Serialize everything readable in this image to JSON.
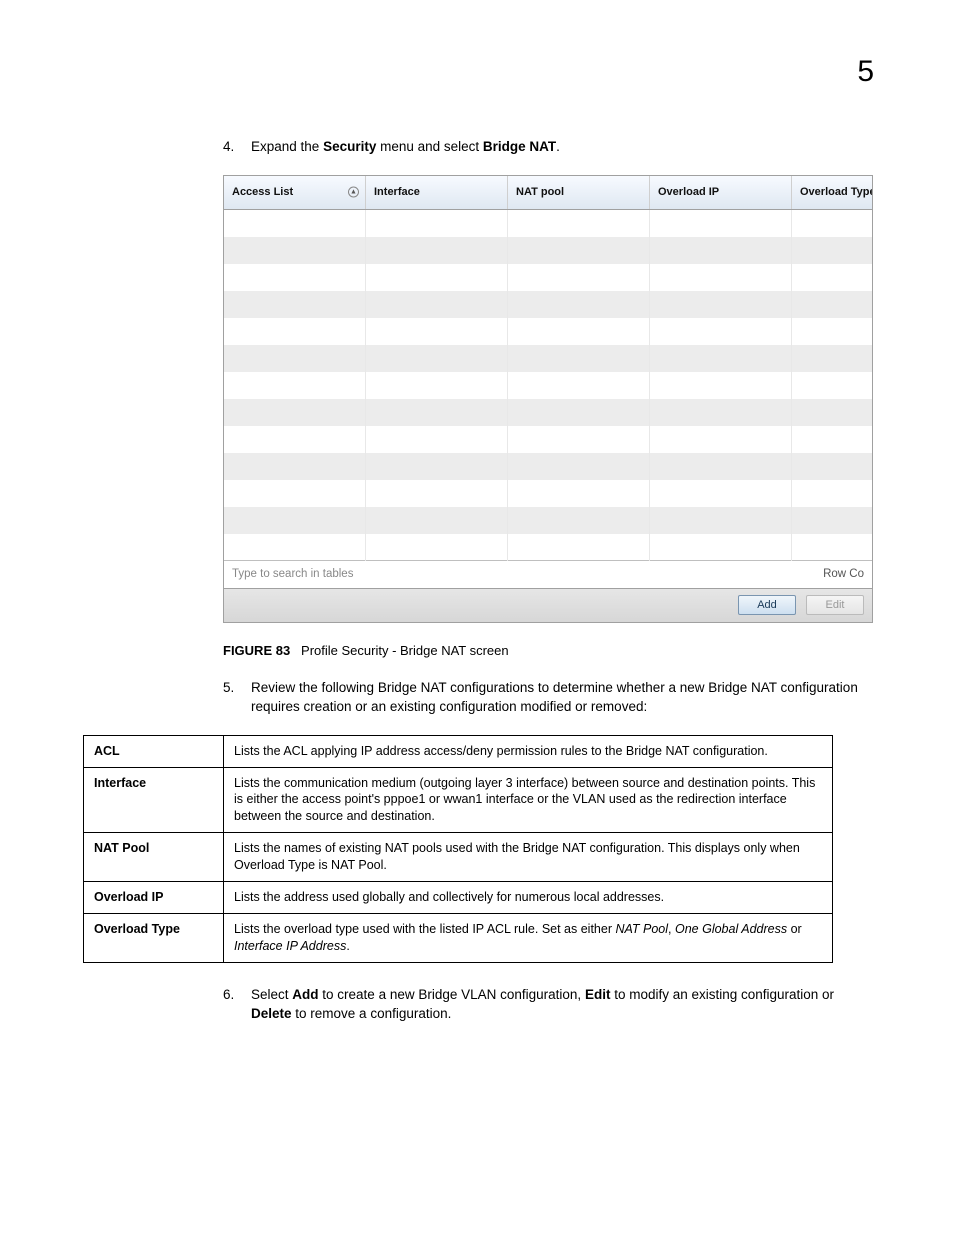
{
  "page_number": "5",
  "steps": {
    "s4": {
      "num": "4.",
      "prefix": "Expand the ",
      "b1": "Security",
      "mid": " menu and select ",
      "b2": "Bridge NAT",
      "suffix": "."
    },
    "s5": {
      "num": "5.",
      "text": "Review the following Bridge NAT configurations to determine whether a new Bridge NAT configuration requires creation or an existing configuration modified or removed:"
    },
    "s6": {
      "num": "6.",
      "p1": "Select ",
      "b1": "Add",
      "p2": " to create a new Bridge VLAN configuration, ",
      "b2": "Edit",
      "p3": " to modify an existing configuration or ",
      "b3": "Delete",
      "p4": " to remove a configuration."
    }
  },
  "figure": {
    "label": "FIGURE 83",
    "caption": "Profile Security - Bridge NAT screen"
  },
  "screenshot": {
    "columns": [
      "Access List",
      "Interface",
      "NAT pool",
      "Overload IP",
      "Overload Type"
    ],
    "search_placeholder": "Type to search in tables",
    "row_count_label": "Row Co",
    "buttons": {
      "add": "Add",
      "edit": "Edit"
    }
  },
  "def_table": [
    {
      "term": "ACL",
      "desc": "Lists the ACL applying IP address access/deny permission rules to the Bridge NAT configuration."
    },
    {
      "term": "Interface",
      "desc": "Lists the communication medium (outgoing layer 3 interface) between source and destination points. This is either the access point's pppoe1 or wwan1 interface or the VLAN used as the redirection interface between the source and destination."
    },
    {
      "term": "NAT Pool",
      "desc": "Lists the names of existing NAT pools used with the Bridge NAT configuration. This displays only when Overload Type is NAT Pool."
    },
    {
      "term": "Overload IP",
      "desc": "Lists the address used globally and collectively for numerous local addresses."
    },
    {
      "term": "Overload Type",
      "desc_pre": "Lists the overload type used with the listed IP ACL rule. Set as either ",
      "i1": "NAT Pool",
      "comma": ", ",
      "i2": "One Global Address",
      "or": " or ",
      "i3": "Interface IP Address",
      "dot": "."
    }
  ]
}
